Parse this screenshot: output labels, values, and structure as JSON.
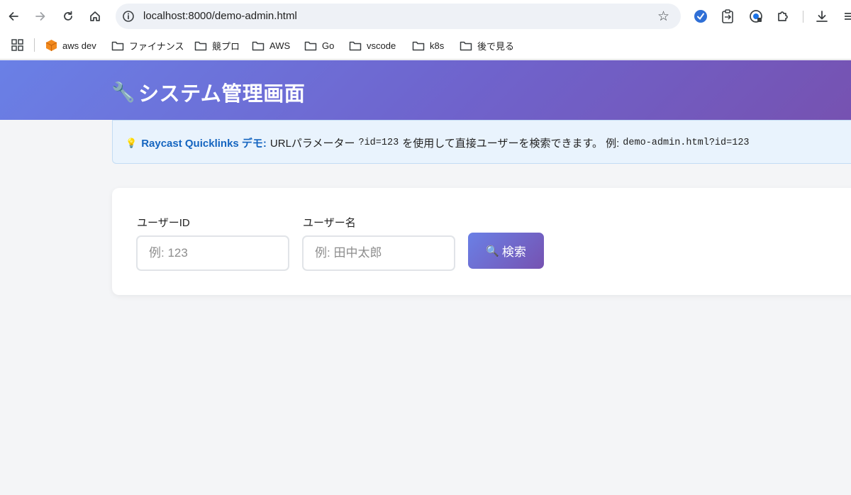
{
  "browser": {
    "url": "localhost:8000/demo-admin.html",
    "bookmarks": [
      {
        "label": "aws dev",
        "icon": "aws-cube-icon"
      },
      {
        "label": "ファイナンス",
        "icon": "folder-icon"
      },
      {
        "label": "競プロ",
        "icon": "folder-icon"
      },
      {
        "label": "AWS",
        "icon": "folder-icon"
      },
      {
        "label": "Go",
        "icon": "folder-icon"
      },
      {
        "label": "vscode",
        "icon": "folder-icon"
      },
      {
        "label": "k8s",
        "icon": "folder-icon"
      },
      {
        "label": "後で見る",
        "icon": "folder-icon"
      }
    ]
  },
  "header": {
    "icon": "wrench-icon",
    "title": "システム管理画面"
  },
  "notice": {
    "icon": "lightbulb-icon",
    "strong": "Raycast Quicklinks デモ:",
    "text1": "URLパラメーター",
    "param": "?id=123",
    "text2": "を使用して直接ユーザーを検索できます。 例:",
    "example": "demo-admin.html?id=123"
  },
  "search": {
    "user_id_label": "ユーザーID",
    "user_id_placeholder": "例: 123",
    "user_name_label": "ユーザー名",
    "user_name_placeholder": "例: 田中太郎",
    "button_label": "検索",
    "button_icon": "magnifier-icon"
  },
  "colors": {
    "header_start": "#6a80e6",
    "header_end": "#7652b1",
    "notice_bg": "#e9f3fd",
    "notice_strong": "#1565c0"
  }
}
